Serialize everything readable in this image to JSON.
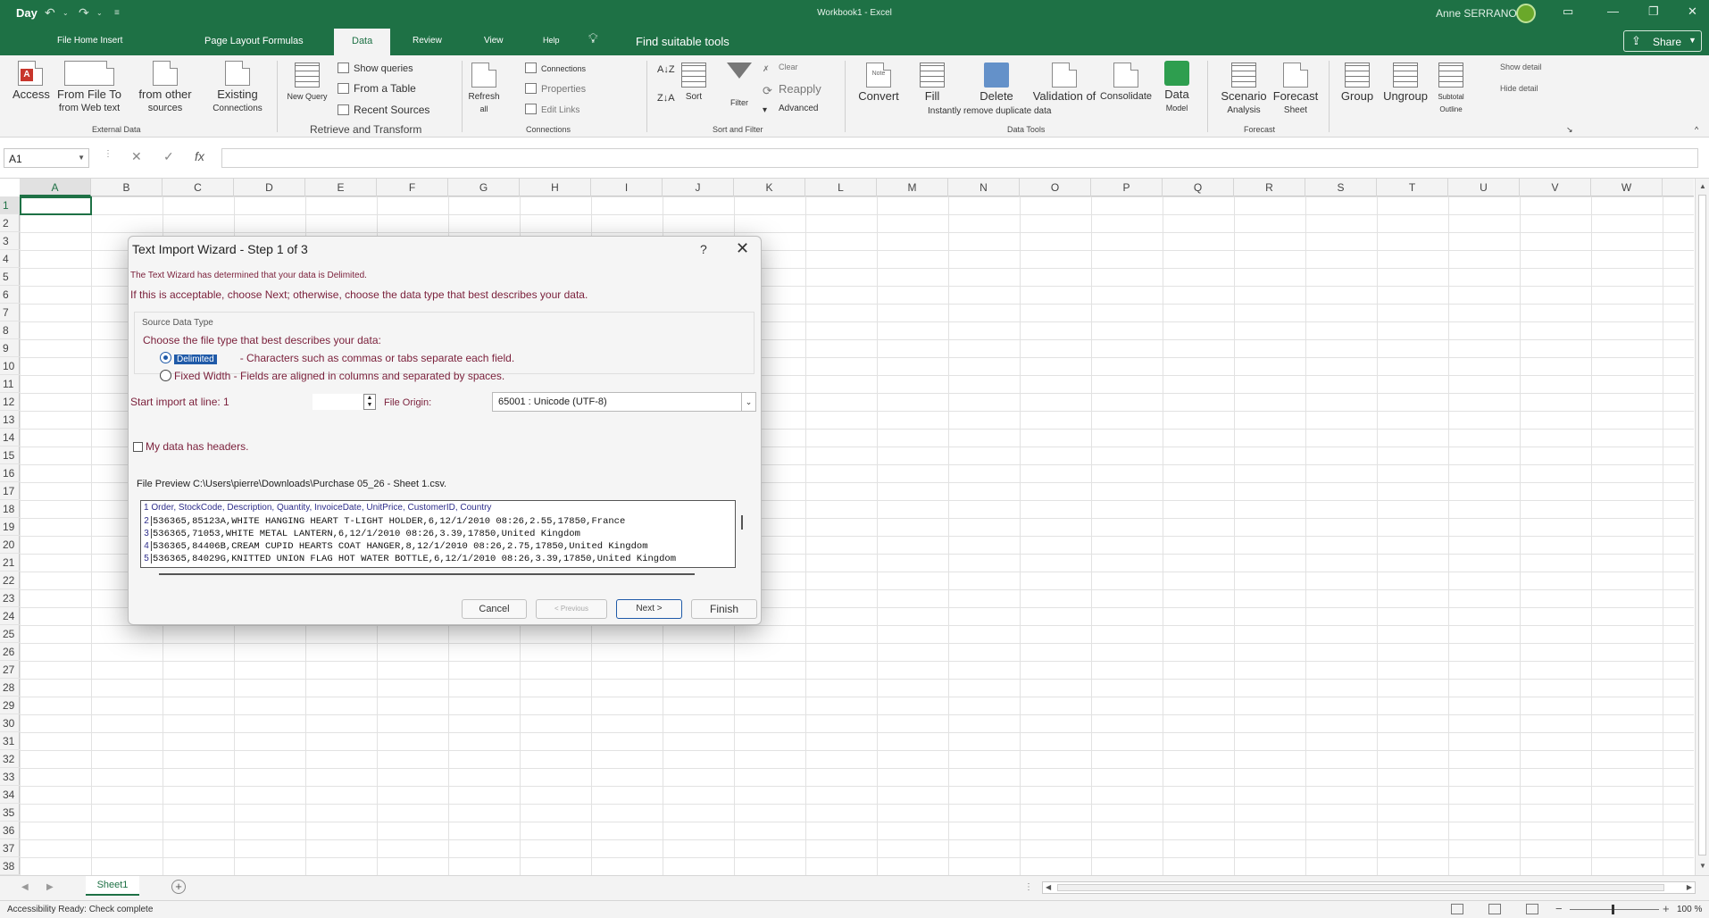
{
  "title_bar": {
    "app_short": "Day",
    "window_title": "Workbook1 - Excel",
    "user_name": "Anne SERRANO"
  },
  "tabs": [
    {
      "label": "File Home Insert"
    },
    {
      "label": "Page Layout Formulas"
    },
    {
      "label": "Data"
    },
    {
      "label": "Review"
    },
    {
      "label": "View"
    },
    {
      "label": "Help"
    },
    {
      "label": "Find suitable tools"
    }
  ],
  "share_label": "Share",
  "ribbon": {
    "access": "Access",
    "from_web": "From File To",
    "from_web_sub": "from Web text",
    "from_other": "from other",
    "from_other_sub": "sources",
    "existing": "Existing",
    "existing_sub": "Connections",
    "external_data": "External Data",
    "new_query": "New Query",
    "show_queries": "Show queries",
    "from_table": "From a Table",
    "recent_sources": "Recent Sources",
    "retrieve_transform": "Retrieve and Transform",
    "refresh": "Refresh",
    "refresh_sub": "all",
    "connections_small": "Connections",
    "properties": "Properties",
    "edit_links": "Edit Links",
    "connections": "Connections",
    "sort": "Sort",
    "filter": "Filter",
    "clear": "Clear",
    "reapply": "Reapply",
    "advanced": "Advanced",
    "sort_filter": "Sort and Filter",
    "note": "Note",
    "convert": "Convert",
    "fill": "Fill",
    "delete": "Delete",
    "fill_delete_sub": "Instantly remove duplicate data",
    "validation": "Validation of",
    "consolidate": "Consolidate",
    "data_model": "Data",
    "data_model_sub": "Model",
    "data_tools": "Data Tools",
    "scenario": "Scenario",
    "scenario_sub": "Analysis",
    "forecast": "Forecast",
    "forecast_sub": "Sheet",
    "forecast_group": "Forecast",
    "group": "Group",
    "ungroup": "Ungroup",
    "subtotal": "Subtotal",
    "outline": "Outline",
    "show_detail": "Show detail",
    "hide_detail": "Hide detail"
  },
  "formula_bar": {
    "name_box": "A1",
    "fx": "fx",
    "value": ""
  },
  "grid": {
    "columns": [
      "A",
      "B",
      "C",
      "D",
      "E",
      "F",
      "G",
      "H",
      "I",
      "J",
      "K",
      "L",
      "M",
      "N",
      "O",
      "P",
      "Q",
      "R",
      "S",
      "T",
      "U",
      "V",
      "W"
    ],
    "rows": [
      "1",
      "2",
      "3",
      "4",
      "5",
      "6",
      "7",
      "8",
      "9",
      "10",
      "11",
      "12",
      "13",
      "14",
      "15",
      "16",
      "17",
      "18",
      "19",
      "20",
      "21",
      "22",
      "23",
      "24",
      "25",
      "26",
      "27",
      "28",
      "29",
      "30",
      "31",
      "32",
      "33",
      "34",
      "35",
      "36",
      "37",
      "38"
    ],
    "selected": "A1"
  },
  "sheet_tab": "Sheet1",
  "status": {
    "left": "Accessibility Ready: Check complete",
    "zoom": "100 %"
  },
  "dialog": {
    "title": "Text Import Wizard - Step 1 of 3",
    "help": "?",
    "line1": "The Text Wizard has determined that your data is Delimited.",
    "line2": "If this is acceptable, choose Next; otherwise, choose the data type that best describes your data.",
    "source_legend": "Source Data Type",
    "choose_label": "Choose the file type that best describes your data:",
    "delimited_label": "Delimited",
    "delimited_desc": "- Characters such as commas or tabs separate each field.",
    "fixed_label": "Fixed Width - Fields are aligned in columns and separated by spaces.",
    "start_label": "Start import at line: 1",
    "start_value": "",
    "origin_label": "File Origin:",
    "origin_value": "65001 : Unicode (UTF-8)",
    "headers_label": "My data has headers.",
    "preview_label": "File Preview C:\\Users\\pierre\\Downloads\\Purchase 05_26 - Sheet 1.csv.",
    "preview_head": "1 Order, StockCode, Description, Quantity, InvoiceDate, UnitPrice, CustomerID, Country",
    "preview_rows": [
      {
        "num": "2",
        "text": "536365,85123A,WHITE HANGING HEART T-LIGHT HOLDER,6,12/1/2010 08:26,2.55,17850,France"
      },
      {
        "num": "3",
        "text": "536365,71053,WHITE METAL LANTERN,6,12/1/2010 08:26,3.39,17850,United Kingdom"
      },
      {
        "num": "4",
        "text": "536365,84406B,CREAM CUPID HEARTS COAT HANGER,8,12/1/2010 08:26,2.75,17850,United Kingdom"
      },
      {
        "num": "5",
        "text": "536365,84029G,KNITTED UNION FLAG HOT WATER BOTTLE,6,12/1/2010 08:26,3.39,17850,United Kingdom"
      }
    ],
    "cancel": "Cancel",
    "previous": "< Previous",
    "next": "Next >",
    "finish": "Finish"
  }
}
